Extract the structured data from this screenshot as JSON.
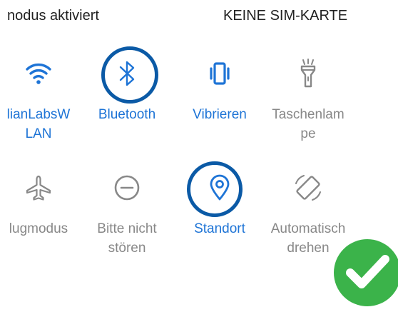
{
  "status_bar": {
    "left_text": "nodus aktiviert",
    "right_text": "KEINE SIM-KARTE"
  },
  "colors": {
    "active": "#1e74d6",
    "inactive": "#888888",
    "highlight_ring": "#0b5aa6",
    "check_green": "#3bb34a"
  },
  "quick_settings": {
    "row1": [
      {
        "label": "lianLabsW\nLAN",
        "icon": "wifi-icon",
        "active": true
      },
      {
        "label": "Bluetooth",
        "icon": "bluetooth-icon",
        "active": true
      },
      {
        "label": "Vibrieren",
        "icon": "vibrate-icon",
        "active": true
      },
      {
        "label": "Taschenlam\npe",
        "icon": "flashlight-icon",
        "active": false
      }
    ],
    "row2": [
      {
        "label": "lugmodus",
        "icon": "airplane-icon",
        "active": false
      },
      {
        "label": "Bitte nicht\nstören",
        "icon": "do-not-disturb-icon",
        "active": false
      },
      {
        "label": "Standort",
        "icon": "location-pin-icon",
        "active": true
      },
      {
        "label": "Automatisch\ndrehen",
        "icon": "auto-rotate-icon",
        "active": false
      }
    ]
  }
}
